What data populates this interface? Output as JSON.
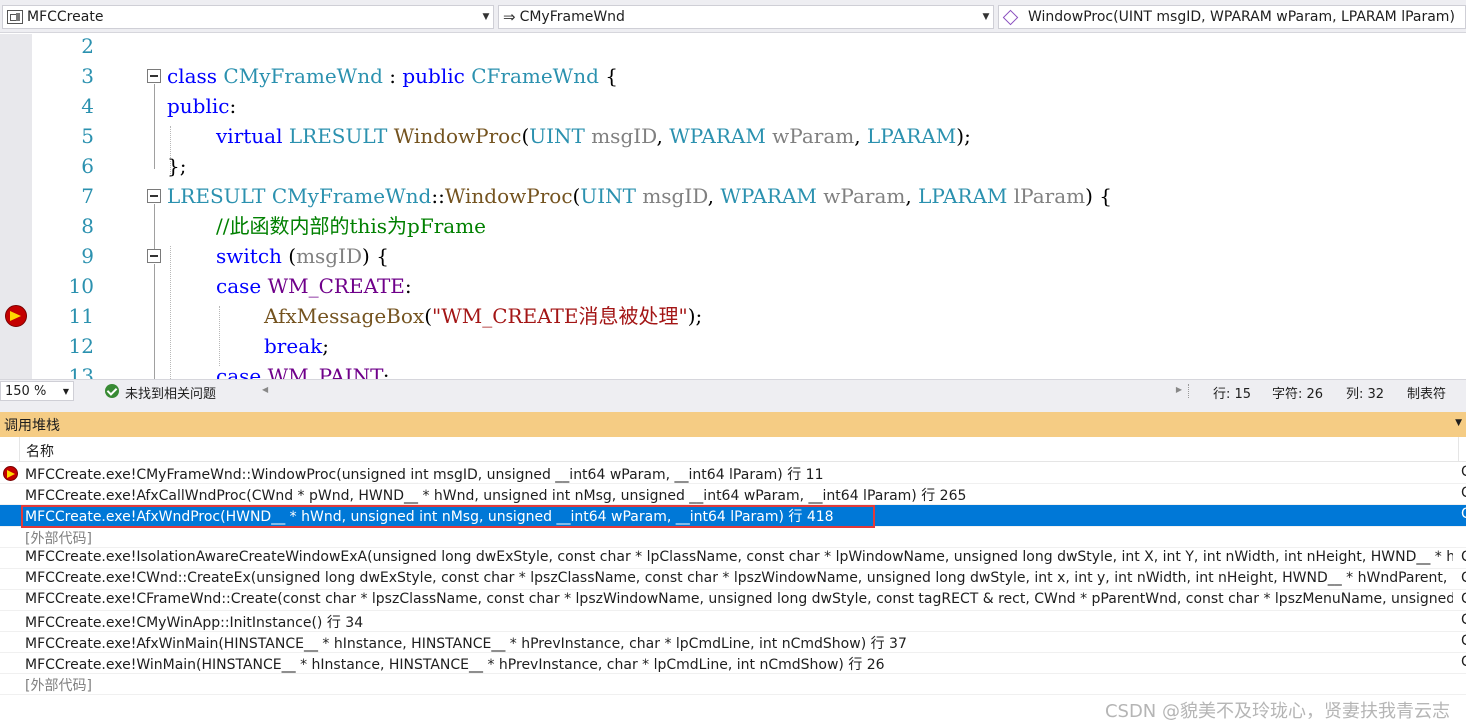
{
  "navbar": {
    "project": "MFCCreate",
    "class": "CMyFrameWnd",
    "member": "WindowProc(UINT msgID, WPARAM wParam, LPARAM lParam)"
  },
  "editor": {
    "line_numbers": [
      "2",
      "3",
      "4",
      "5",
      "6",
      "7",
      "8",
      "9",
      "10",
      "11",
      "12",
      "13"
    ],
    "code": {
      "l3_class": "class",
      "l3_name": "CMyFrameWnd",
      "l3_colon": " : ",
      "l3_public": "public",
      "l3_base": "CFrameWnd",
      "l3_brace": " {",
      "l4_public": "public",
      "l4_colon": ":",
      "l5_virtual": "virtual",
      "l5_lresult": "LRESULT",
      "l5_fn": "WindowProc",
      "l5_p1": "(",
      "l5_uint": "UINT",
      "l5_msgid": "msgID",
      "l5_c1": ", ",
      "l5_wparam": "WPARAM",
      "l5_wp": "wParam",
      "l5_c2": ", ",
      "l5_lparam": "LPARAM",
      "l5_end": ");",
      "l6_end": "};",
      "l7_lresult": "LRESULT",
      "l7_cls": "CMyFrameWnd",
      "l7_scope": "::",
      "l7_fn": "WindowProc",
      "l7_p1": "(",
      "l7_uint": "UINT",
      "l7_msgid": "msgID",
      "l7_c1": ", ",
      "l7_wparam": "WPARAM",
      "l7_wp": "wParam",
      "l7_c2": ", ",
      "l7_lparam": "LPARAM",
      "l7_lp": "lParam",
      "l7_end": ") {",
      "l8_comment": "//此函数内部的this为pFrame",
      "l9_switch": "switch",
      "l9_open": " (",
      "l9_msgid": "msgID",
      "l9_end": ") {",
      "l10_case": "case",
      "l10_sp": " ",
      "l10_macro": "WM_CREATE",
      "l10_colon": ":",
      "l11_fn": "AfxMessageBox",
      "l11_p1": "(",
      "l11_str": "\"WM_CREATE消息被处理\"",
      "l11_end": ");",
      "l12_break": "break",
      "l12_end": ";",
      "l13_case": "case",
      "l13_sp": " ",
      "l13_macro": "WM_PAINT",
      "l13_colon": ":"
    }
  },
  "status": {
    "zoom": "150 %",
    "issues": "未找到相关问题",
    "line": "行: 15",
    "char": "字符: 26",
    "col": "列: 32",
    "tab": "制表符"
  },
  "callstack": {
    "title": "调用堆栈",
    "column_name": "名称",
    "rows": [
      {
        "text": "MFCCreate.exe!CMyFrameWnd::WindowProc(unsigned int msgID, unsigned __int64 wParam, __int64 lParam) 行 11",
        "lang": "C++"
      },
      {
        "text": "MFCCreate.exe!AfxCallWndProc(CWnd * pWnd, HWND__ * hWnd, unsigned int nMsg, unsigned __int64 wParam, __int64 lParam) 行 265",
        "lang": "C++"
      },
      {
        "text": "MFCCreate.exe!AfxWndProc(HWND__ * hWnd, unsigned int nMsg, unsigned __int64 wParam, __int64 lParam) 行 418",
        "lang": "C++"
      },
      {
        "text": "[外部代码]",
        "lang": ""
      },
      {
        "text": "MFCCreate.exe!IsolationAwareCreateWindowExA(unsigned long dwExStyle, const char * lpClassName, const char * lpWindowName, unsigned long dwStyle, int X, int Y, int nWidth, int nHeight, HWND__ * hWndParent, ...",
        "lang": "C++"
      },
      {
        "text": "MFCCreate.exe!CWnd::CreateEx(unsigned long dwExStyle, const char * lpszClassName, const char * lpszWindowName, unsigned long dwStyle, int x, int y, int nWidth, int nHeight, HWND__ * hWndParent, HMENU__ * nID...",
        "lang": "C++"
      },
      {
        "text": "MFCCreate.exe!CFrameWnd::Create(const char * lpszClassName, const char * lpszWindowName, unsigned long dwStyle, const tagRECT & rect, CWnd * pParentWnd, const char * lpszMenuName, unsigned long dwExSty...",
        "lang": "C++"
      },
      {
        "text": "MFCCreate.exe!CMyWinApp::InitInstance() 行 34",
        "lang": "C++"
      },
      {
        "text": "MFCCreate.exe!AfxWinMain(HINSTANCE__ * hInstance, HINSTANCE__ * hPrevInstance, char * lpCmdLine, int nCmdShow) 行 37",
        "lang": "C++"
      },
      {
        "text": "MFCCreate.exe!WinMain(HINSTANCE__ * hInstance, HINSTANCE__ * hPrevInstance, char * lpCmdLine, int nCmdShow) 行 26",
        "lang": "C++"
      },
      {
        "text": "[外部代码]",
        "lang": ""
      }
    ]
  },
  "watermark": "CSDN @貌美不及玲珑心，贤妻扶我青云志"
}
